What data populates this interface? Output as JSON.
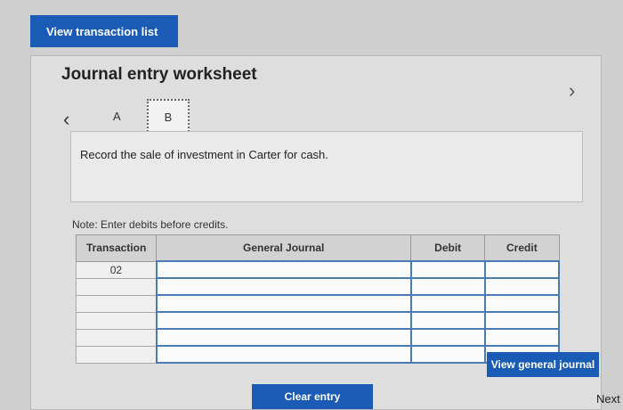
{
  "top_button": "View transaction list",
  "worksheet": {
    "title": "Journal entry worksheet",
    "tabs": [
      "A",
      "B"
    ],
    "description": "Record the sale of investment in Carter for cash.",
    "note": "Note: Enter debits before credits."
  },
  "table": {
    "headers": {
      "transaction": "Transaction",
      "journal": "General Journal",
      "debit": "Debit",
      "credit": "Credit"
    },
    "transaction_value": "02"
  },
  "buttons": {
    "clear_entry": "Clear entry",
    "view_general_journal": "View general journal"
  },
  "footer": {
    "next": "Next"
  }
}
